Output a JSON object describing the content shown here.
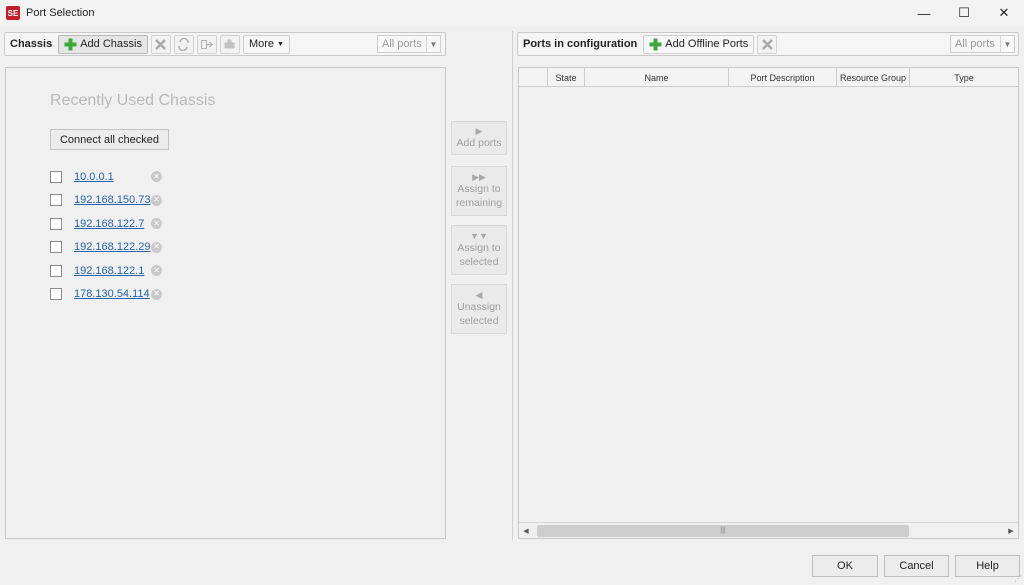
{
  "window": {
    "app_icon_text": "SE",
    "title": "Port Selection",
    "controls": [
      "—",
      "☐",
      "✕"
    ]
  },
  "chassis_toolbar": {
    "title": "Chassis",
    "add_chassis": "Add Chassis",
    "more": "More",
    "filter_value": "All ports"
  },
  "recent": {
    "title": "Recently Used Chassis",
    "connect_all": "Connect all checked",
    "items": [
      {
        "ip": "10.0.0.1",
        "checked": false
      },
      {
        "ip": "192.168.150.73",
        "checked": false
      },
      {
        "ip": "192.168.122.7",
        "checked": false
      },
      {
        "ip": "192.168.122.29",
        "checked": false
      },
      {
        "ip": "192.168.122.1",
        "checked": false
      },
      {
        "ip": "178.130.54.114",
        "checked": false
      }
    ]
  },
  "middle_buttons": {
    "add_ports": [
      "Add ports"
    ],
    "assign_remaining": [
      "Assign to",
      "remaining"
    ],
    "assign_selected": [
      "Assign to",
      "selected"
    ],
    "unassign_selected": [
      "Unassign",
      "selected"
    ]
  },
  "ports_toolbar": {
    "title": "Ports in configuration",
    "add_offline": "Add Offline Ports",
    "filter_value": "All ports"
  },
  "grid": {
    "columns": [
      "",
      "State",
      "Name",
      "Port Description",
      "Resource Group",
      "Type"
    ]
  },
  "footer": {
    "ok": "OK",
    "cancel": "Cancel",
    "help": "Help"
  },
  "colors": {
    "link": "#2464b0",
    "add_icon_green": "#3fa83a",
    "disabled_text": "#9e9e9e"
  }
}
